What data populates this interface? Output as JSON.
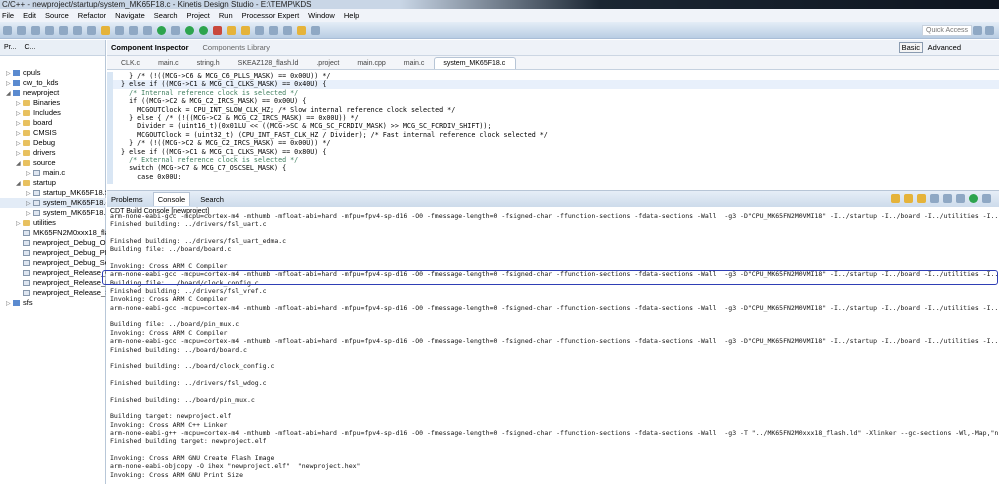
{
  "window": {
    "title": "C/C++ - newproject/startup/system_MK65F18.c - Kinetis Design Studio - E:\\TEMP\\KDS"
  },
  "menu": [
    "File",
    "Edit",
    "Source",
    "Refactor",
    "Navigate",
    "Search",
    "Project",
    "Run",
    "Processor Expert",
    "Window",
    "Help"
  ],
  "toolbar": {
    "quick_access_placeholder": "Quick Access"
  },
  "left_panel": {
    "tabs": [
      "Pr...",
      "C..."
    ],
    "tree": [
      {
        "label": "cpuls",
        "depth": 0,
        "type": "proj",
        "tw": "▷"
      },
      {
        "label": "cw_to_kds",
        "depth": 0,
        "type": "proj",
        "tw": "▷"
      },
      {
        "label": "newproject",
        "depth": 0,
        "type": "proj",
        "tw": "◢"
      },
      {
        "label": "Binaries",
        "depth": 1,
        "type": "folder",
        "tw": "▷"
      },
      {
        "label": "Includes",
        "depth": 1,
        "type": "folder",
        "tw": "▷"
      },
      {
        "label": "board",
        "depth": 1,
        "type": "folder",
        "tw": "▷"
      },
      {
        "label": "CMSIS",
        "depth": 1,
        "type": "folder",
        "tw": "▷"
      },
      {
        "label": "Debug",
        "depth": 1,
        "type": "folder",
        "tw": "▷"
      },
      {
        "label": "drivers",
        "depth": 1,
        "type": "folder",
        "tw": "▷"
      },
      {
        "label": "source",
        "depth": 1,
        "type": "folder",
        "tw": "◢"
      },
      {
        "label": "main.c",
        "depth": 2,
        "type": "file",
        "tw": "▷"
      },
      {
        "label": "startup",
        "depth": 1,
        "type": "folder",
        "tw": "◢"
      },
      {
        "label": "startup_MK65F18.S",
        "depth": 2,
        "type": "file",
        "tw": "▷"
      },
      {
        "label": "system_MK65F18.c",
        "depth": 2,
        "type": "file",
        "tw": "▷"
      },
      {
        "label": "system_MK65F18.h",
        "depth": 2,
        "type": "file",
        "tw": "▷"
      },
      {
        "label": "utilities",
        "depth": 1,
        "type": "folder",
        "tw": "▷"
      },
      {
        "label": "MK65FN2M0xxx18_flash",
        "depth": 1,
        "type": "file",
        "tw": ""
      },
      {
        "label": "newproject_Debug_Op",
        "depth": 1,
        "type": "file",
        "tw": ""
      },
      {
        "label": "newproject_Debug_PN",
        "depth": 1,
        "type": "file",
        "tw": ""
      },
      {
        "label": "newproject_Debug_Seg",
        "depth": 1,
        "type": "file",
        "tw": ""
      },
      {
        "label": "newproject_Release_O",
        "depth": 1,
        "type": "file",
        "tw": ""
      },
      {
        "label": "newproject_Release_P",
        "depth": 1,
        "type": "file",
        "tw": ""
      },
      {
        "label": "newproject_Release_Se",
        "depth": 1,
        "type": "file",
        "tw": ""
      },
      {
        "label": "sfs",
        "depth": 0,
        "type": "proj",
        "tw": "▷"
      }
    ]
  },
  "editor": {
    "view_tabs": {
      "active": "Component Inspector",
      "other": "Components Library",
      "basic": "Basic",
      "advanced": "Advanced"
    },
    "file_tabs": [
      "CLK.c",
      "main.c",
      "string.h",
      "SKEAZ128_flash.ld",
      ".project",
      "main.cpp",
      "main.c",
      "system_MK65F18.c"
    ],
    "active_file_tab": 7,
    "code": [
      "    } /* (!((MCG->C6 & MCG_C6_PLLS_MASK) == 0x00U)) */",
      "  } else if ((MCG->C1 & MCG_C1_CLKS_MASK) == 0x40U) {",
      "    /* Internal reference clock is selected */",
      "    if ((MCG->C2 & MCG_C2_IRCS_MASK) == 0x00U) {",
      "      MCGOUTClock = CPU_INT_SLOW_CLK_HZ; /* Slow internal reference clock selected */",
      "    } else { /* (!((MCG->C2 & MCG_C2_IRCS_MASK) == 0x00U)) */",
      "      Divider = (uint16_t)(0x01LU << ((MCG->SC & MCG_SC_FCRDIV_MASK) >> MCG_SC_FCRDIV_SHIFT));",
      "      MCGOUTClock = (uint32_t) (CPU_INT_FAST_CLK_HZ / Divider); /* Fast internal reference clock selected */",
      "    } /* (!((MCG->C2 & MCG_C2_IRCS_MASK) == 0x00U)) */",
      "  } else if ((MCG->C1 & MCG_C1_CLKS_MASK) == 0x80U) {",
      "    /* External reference clock is selected */",
      "    switch (MCG->C7 & MCG_C7_OSCSEL_MASK) {",
      "      case 0x00U:"
    ]
  },
  "console": {
    "tabs": [
      "Problems",
      "Console",
      "Search"
    ],
    "label": "CDT Build Console [newproject]",
    "lines": [
      "arm-none-eabi-gcc -mcpu=cortex-m4 -mthumb -mfloat-abi=hard -mfpu=fpv4-sp-d16 -O0 -fmessage-length=0 -fsigned-char -ffunction-sections -fdata-sections -Wall  -g3 -D\"CPU_MK65FN2M0VMI18\" -I../startup -I../board -I../utilities -I...",
      "Finished building: ../drivers/fsl_uart.c",
      "",
      "Finished building: ../drivers/fsl_uart_edma.c",
      "Building file: ../board/board.c",
      "",
      "Invoking: Cross ARM C Compiler",
      "arm-none-eabi-gcc -mcpu=cortex-m4 -mthumb -mfloat-abi=hard -mfpu=fpv4-sp-d16 -O0 -fmessage-length=0 -fsigned-char -ffunction-sections -fdata-sections -Wall  -g3 -D\"CPU_MK65FN2M0VMI18\" -I../startup -I../board -I../utilities -I..",
      "Building file: ../board/clock_config.c",
      "Finished building: ../drivers/fsl_vref.c",
      "Invoking: Cross ARM C Compiler",
      "arm-none-eabi-gcc -mcpu=cortex-m4 -mthumb -mfloat-abi=hard -mfpu=fpv4-sp-d16 -O0 -fmessage-length=0 -fsigned-char -ffunction-sections -fdata-sections -Wall  -g3 -D\"CPU_MK65FN2M0VMI18\" -I../startup -I../board -I../utilities -I...",
      "",
      "Building file: ../board/pin_mux.c",
      "Invoking: Cross ARM C Compiler",
      "arm-none-eabi-gcc -mcpu=cortex-m4 -mthumb -mfloat-abi=hard -mfpu=fpv4-sp-d16 -O0 -fmessage-length=0 -fsigned-char -ffunction-sections -fdata-sections -Wall  -g3 -D\"CPU_MK65FN2M0VMI18\" -I../startup -I../board -I../utilities -I...",
      "Finished building: ../board/board.c",
      "",
      "Finished building: ../board/clock_config.c",
      "",
      "Finished building: ../drivers/fsl_wdog.c",
      "",
      "Finished building: ../board/pin_mux.c",
      "",
      "Building target: newproject.elf",
      "Invoking: Cross ARM C++ Linker",
      "arm-none-eabi-g++ -mcpu=cortex-m4 -mthumb -mfloat-abi=hard -mfpu=fpv4-sp-d16 -O0 -fmessage-length=0 -fsigned-char -ffunction-sections -fdata-sections -Wall  -g3 -T \"../MK65FN2M0xxx18_flash.ld\" -Xlinker --gc-sections -Wl,-Map,\"n",
      "Finished building target: newproject.elf",
      "",
      "Invoking: Cross ARM GNU Create Flash Image",
      "arm-none-eabi-objcopy -O ihex \"newproject.elf\"  \"newproject.hex\"",
      "Invoking: Cross ARM GNU Print Size"
    ],
    "highlighted_line": 7,
    "highlight_color": "#2f3fb5"
  }
}
